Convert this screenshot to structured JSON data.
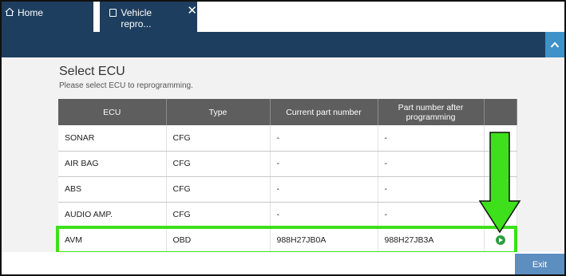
{
  "tabs": {
    "home_label": "Home",
    "active_label": "Vehicle repro...",
    "close_glyph": "✕"
  },
  "header": {
    "collapse_icon": "chevron-up-icon"
  },
  "page": {
    "title": "Select ECU",
    "subtitle": "Please select ECU to reprogramming."
  },
  "table": {
    "columns": [
      "ECU",
      "Type",
      "Current part number",
      "Part number after programming",
      ""
    ],
    "rows": [
      {
        "ecu": "SONAR",
        "type": "CFG",
        "current": "-",
        "after": "-"
      },
      {
        "ecu": "AIR BAG",
        "type": "CFG",
        "current": "-",
        "after": "-"
      },
      {
        "ecu": "ABS",
        "type": "CFG",
        "current": "-",
        "after": "-"
      },
      {
        "ecu": "AUDIO AMP.",
        "type": "CFG",
        "current": "-",
        "after": "-"
      },
      {
        "ecu": "AVM",
        "type": "OBD",
        "current": "988H27JB0A",
        "after": "988H27JB3A"
      }
    ]
  },
  "footer": {
    "exit_label": "Exit"
  },
  "colors": {
    "header_blue": "#1d3e5e",
    "highlight_green": "#3de01a",
    "play_green": "#2b9f3f",
    "exit_blue": "#5c8ec0"
  }
}
